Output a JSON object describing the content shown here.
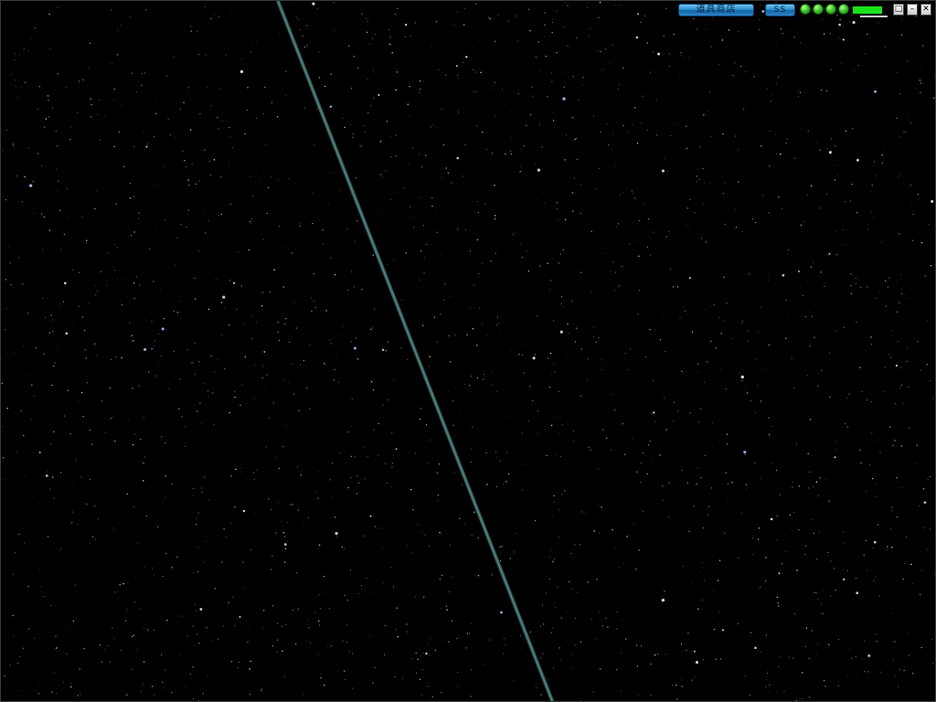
{
  "hud": {
    "shop_label": "道具商店",
    "ss_label": "SS",
    "lives_count": 4,
    "energy_level": 0.85,
    "colors": {
      "button_blue": "#2c8fd0",
      "life_green": "#40c82c",
      "energy_green": "#18e21a"
    }
  },
  "window_controls": {
    "menu_icon": "□",
    "minimize_icon": "–",
    "close_icon": "✕"
  },
  "scene": {
    "background": "#000000",
    "beam_color": "#4d8a86"
  }
}
